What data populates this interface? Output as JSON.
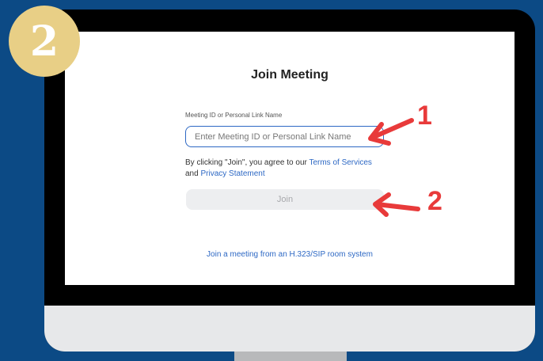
{
  "badge": {
    "step_number": "2"
  },
  "join_screen": {
    "title": "Join Meeting",
    "field_label": "Meeting ID or Personal Link Name",
    "input_placeholder": "Enter Meeting ID or Personal Link Name",
    "input_value": "",
    "consent_prefix": "By clicking \"Join\", you agree to our ",
    "terms_link": "Terms of Services",
    "consent_and": " and ",
    "privacy_link": "Privacy Statement",
    "join_button_label": "Join",
    "h323_link": "Join a meeting from an H.323/SIP room system"
  },
  "annotations": {
    "arrow_1_label": "1",
    "arrow_2_label": "2",
    "arrow_color": "#e83a3a"
  },
  "colors": {
    "background": "#0c4a85",
    "badge": "#e8cf86",
    "link": "#2d68c4",
    "join_button_disabled": "#edeef0"
  }
}
